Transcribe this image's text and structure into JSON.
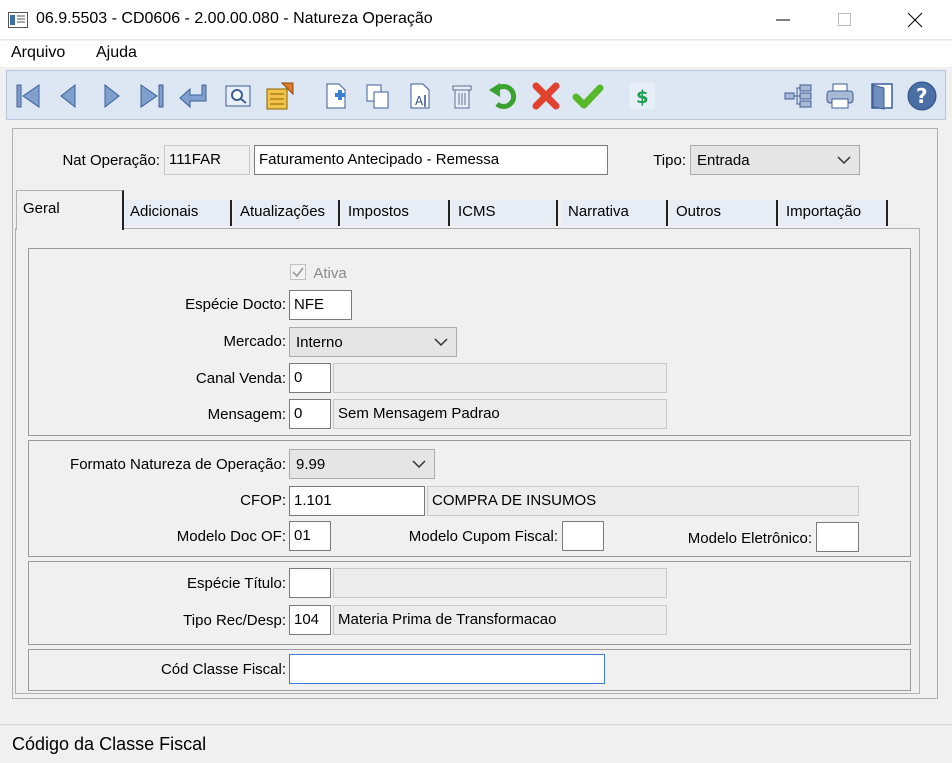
{
  "window": {
    "title": "06.9.5503 - CD0606 - 2.00.00.080 - Natureza Operação"
  },
  "menu": {
    "items": [
      "Arquivo",
      "Ajuda"
    ]
  },
  "toolbar": {
    "buttons_left": [
      "first-icon",
      "previous-icon",
      "next-icon",
      "last-icon",
      "goto-icon",
      "search-icon",
      "list-icon"
    ],
    "buttons_edit": [
      "new-icon",
      "copy-icon",
      "edit-icon",
      "delete-icon",
      "undo-icon",
      "cancel-icon",
      "save-icon",
      "dollar-icon"
    ],
    "buttons_right": [
      "tree-icon",
      "print-icon",
      "exit-icon",
      "help-icon"
    ],
    "dollar_symbol": "$",
    "help_symbol": "?"
  },
  "header": {
    "nat_operacao_label": "Nat Operação:",
    "nat_operacao_code": "111FAR",
    "nat_operacao_desc": "Faturamento Antecipado - Remessa",
    "tipo_label": "Tipo:",
    "tipo_value": "Entrada"
  },
  "tabs": [
    {
      "label": "Geral"
    },
    {
      "label": "Adicionais"
    },
    {
      "label": "Atualizações"
    },
    {
      "label": "Impostos"
    },
    {
      "label": "ICMS"
    },
    {
      "label": "Narrativa"
    },
    {
      "label": "Outros"
    },
    {
      "label": "Importação"
    }
  ],
  "geral": {
    "ativa_label": "Ativa",
    "especie_docto_label": "Espécie Docto:",
    "especie_docto_value": "NFE",
    "mercado_label": "Mercado:",
    "mercado_value": "Interno",
    "canal_venda_label": "Canal Venda:",
    "canal_venda_code": "0",
    "canal_venda_desc": "",
    "mensagem_label": "Mensagem:",
    "mensagem_code": "0",
    "mensagem_desc": "Sem Mensagem Padrao",
    "formato_label": "Formato Natureza de Operação:",
    "formato_value": "9.99",
    "cfop_label": "CFOP:",
    "cfop_code": "1.101",
    "cfop_desc": "COMPRA DE INSUMOS",
    "modelo_doc_of_label": "Modelo Doc OF:",
    "modelo_doc_of_value": "01",
    "modelo_cupom_label": "Modelo Cupom Fiscal:",
    "modelo_cupom_value": "",
    "modelo_eletronico_label": "Modelo Eletrônico:",
    "modelo_eletronico_value": "",
    "especie_titulo_label": "Espécie Título:",
    "especie_titulo_code": "",
    "especie_titulo_desc": "",
    "tipo_rec_label": "Tipo Rec/Desp:",
    "tipo_rec_code": "104",
    "tipo_rec_desc": "Materia Prima de Transformacao",
    "cod_classe_label": "Cód Classe Fiscal:",
    "cod_classe_value": ""
  },
  "status": {
    "text": "Código da Classe Fiscal"
  }
}
